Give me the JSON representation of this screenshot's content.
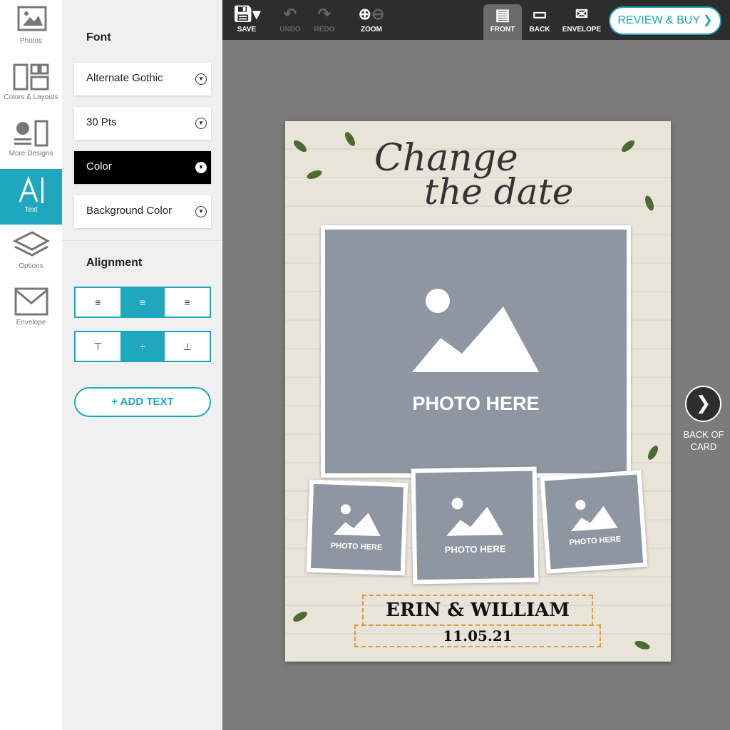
{
  "sidebar": {
    "items": [
      {
        "label": "Photos",
        "icon": "photos-icon"
      },
      {
        "label": "Colors & Layouts",
        "icon": "layouts-icon"
      },
      {
        "label": "More Designs",
        "icon": "designs-icon"
      },
      {
        "label": "Text",
        "icon": "text-icon",
        "active": true
      },
      {
        "label": "Options",
        "icon": "options-icon"
      },
      {
        "label": "Envelope",
        "icon": "envelope-icon"
      }
    ]
  },
  "panel": {
    "font_title": "Font",
    "font": "Alternate Gothic",
    "size": "30 Pts",
    "color": "Color",
    "bg_color": "Background Color",
    "alignment_title": "Alignment",
    "horizontal_align": "center",
    "vertical_align": "middle",
    "add_text": "+ ADD TEXT"
  },
  "toolbar": {
    "save": "SAVE",
    "undo": "UNDO",
    "redo": "REDO",
    "zoom": "ZOOM",
    "front": "FRONT",
    "back": "BACK",
    "envelope": "ENVELOPE",
    "review": "REVIEW & BUY ❯"
  },
  "card": {
    "title1": "Change",
    "title2": "the date",
    "photo_main": "PHOTO HERE",
    "photo_small": [
      "PHOTO HERE",
      "PHOTO HERE",
      "PHOTO HERE"
    ],
    "names": "ERIN & WILLIAM",
    "date": "11.05.21"
  },
  "nav": {
    "next_label": "BACK OF CARD"
  },
  "colors": {
    "accent": "#1ea7be",
    "toolbar": "#2d2d2d",
    "placeholder": "#8e96a1",
    "dash": "#e09a3a"
  }
}
